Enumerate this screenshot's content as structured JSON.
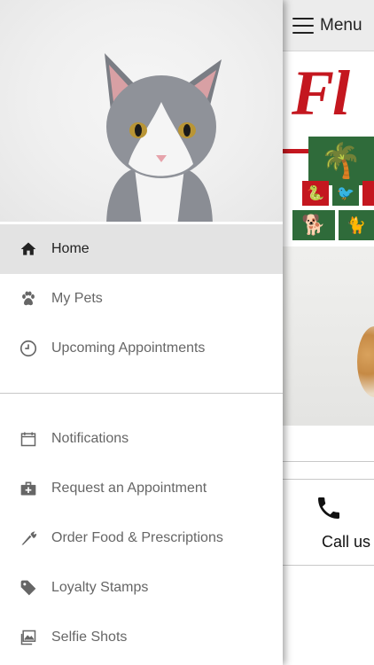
{
  "topbar": {
    "menu_label": "Menu"
  },
  "call_card": {
    "label": "Call us"
  },
  "drawer": {
    "primary_items": [
      {
        "label": "Home",
        "icon": "home-icon",
        "active": true
      },
      {
        "label": "My Pets",
        "icon": "paw-icon",
        "active": false
      },
      {
        "label": "Upcoming Appointments",
        "icon": "clock-icon",
        "active": false
      }
    ],
    "secondary_items": [
      {
        "label": "Notifications",
        "icon": "calendar-icon"
      },
      {
        "label": "Request an Appointment",
        "icon": "medical-kit-icon"
      },
      {
        "label": "Order Food & Prescriptions",
        "icon": "carrot-icon"
      },
      {
        "label": "Loyalty Stamps",
        "icon": "tag-icon"
      },
      {
        "label": "Selfie Shots",
        "icon": "photos-icon"
      }
    ]
  },
  "colors": {
    "active_row": "#e3e3e3",
    "icon_gray": "#666666",
    "brand_red": "#c4171f",
    "brand_green": "#2f6b3a"
  }
}
